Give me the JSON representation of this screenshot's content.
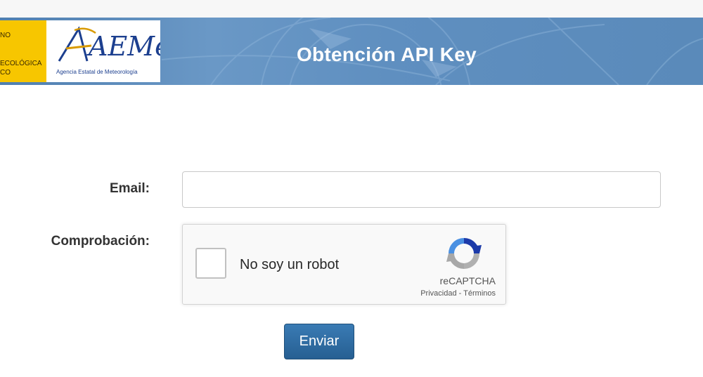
{
  "header": {
    "title": "Obtención API Key",
    "gov_logo_lines": [
      "NO",
      "ECOLÓGICA",
      "CO"
    ],
    "aemet_logo_text": "AEMet",
    "aemet_logo_subtitle": "Agencia Estatal de Meteorología"
  },
  "form": {
    "email_label": "Email:",
    "email_value": "",
    "check_label": "Comprobación:",
    "submit_label": "Enviar"
  },
  "captcha": {
    "checkbox_label": "No soy un robot",
    "brand": "reCAPTCHA",
    "privacy_link": "Privacidad",
    "separator": " - ",
    "terms_link": "Términos",
    "icon": "recaptcha-logo-icon"
  },
  "colors": {
    "banner": "#5f8fc0",
    "gov_yellow": "#f7c600",
    "aemet_blue": "#1c3f8f",
    "button": "#2c6aa0"
  }
}
